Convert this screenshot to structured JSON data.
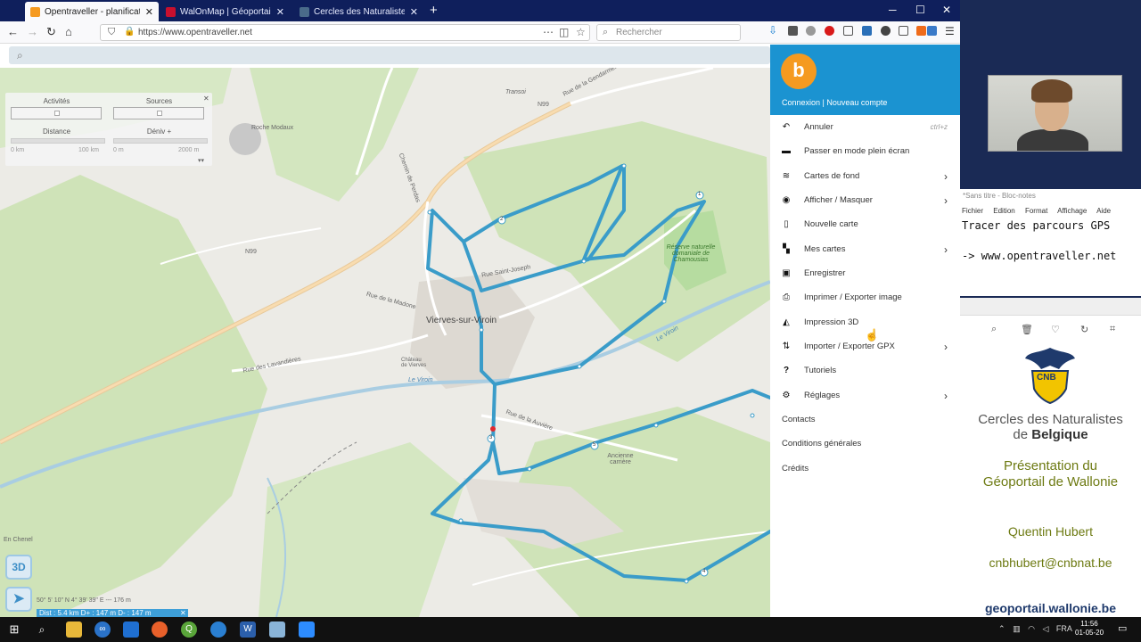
{
  "browser": {
    "tabs": [
      {
        "label": "Opentraveller - planificateur d'it",
        "color": "#f59a20",
        "active": true
      },
      {
        "label": "WalOnMap | Géoportail de la W",
        "color": "#c8102e",
        "active": false
      },
      {
        "label": "Cercles des Naturalistes de Belg",
        "color": "#4a6b8a",
        "active": false
      }
    ],
    "url": "https://www.opentraveller.net",
    "search_placeholder": "Rechercher"
  },
  "filter_panel": {
    "activities_label": "Activités",
    "sources_label": "Sources",
    "distance_label": "Distance",
    "elevation_label": "Déniv +",
    "dist_min": "0 km",
    "dist_max": "100 km",
    "elev_min": "0 m",
    "elev_max": "2000 m"
  },
  "map_labels": {
    "roche_modaux": "Roche Modaux",
    "n99_a": "N99",
    "n99_b": "N99",
    "gendarmerie": "Rue de la Gendarmerie",
    "transoi": "Transoi",
    "viroinval": "Vierves-sur-Viroin",
    "reserve": "Réserve naturelle domaniale de Chamousias",
    "lavandieres": "Rue des Lavandières",
    "viroin": "Le Viroin",
    "viroin2": "Le Viroin",
    "chenel": "En Chenel",
    "ancienne": "Ancienne carrière",
    "chateau": "Château de Vierves",
    "sinsel": "Rue Saint-Joseph",
    "chemin": "Chemin de Perdas",
    "modave": "Rue de la Madone",
    "auviere": "Rue de la Auvière"
  },
  "route_markers": [
    "1",
    "2",
    "3",
    "4",
    "5"
  ],
  "map_footer": {
    "coords": "50° 5' 10\" N  4° 39' 39\" E  ---  176 m",
    "dist": "Dist : 5.4 km   D+ : 147 m   D- : 147 m",
    "btn_3d": "3D"
  },
  "menu": {
    "logo": "b",
    "login": "Connexion | Nouveau compte",
    "items": [
      {
        "label": "Annuler",
        "icon": "undo-icon",
        "glyph": "↶",
        "shortcut": "ctrl+z",
        "arrow": false
      },
      {
        "label": "Passer en mode plein écran",
        "icon": "fullscreen-icon",
        "glyph": "▬",
        "shortcut": "",
        "arrow": false
      },
      {
        "label": "Cartes de fond",
        "icon": "layers-icon",
        "glyph": "≋",
        "shortcut": "",
        "arrow": true
      },
      {
        "label": "Afficher / Masquer",
        "icon": "eye-icon",
        "glyph": "◉",
        "shortcut": "",
        "arrow": true
      },
      {
        "label": "Nouvelle carte",
        "icon": "new-file-icon",
        "glyph": "▯",
        "shortcut": "",
        "arrow": false
      },
      {
        "label": "Mes cartes",
        "icon": "map-icon",
        "glyph": "▚",
        "shortcut": "",
        "arrow": true
      },
      {
        "label": "Enregistrer",
        "icon": "save-icon",
        "glyph": "▣",
        "shortcut": "",
        "arrow": false
      },
      {
        "label": "Imprimer / Exporter image",
        "icon": "printer-icon",
        "glyph": "⎙",
        "shortcut": "",
        "arrow": false
      },
      {
        "label": "Impression 3D",
        "icon": "print-3d-icon",
        "glyph": "◭",
        "shortcut": "",
        "arrow": false
      },
      {
        "label": "Importer / Exporter GPX",
        "icon": "import-export-icon",
        "glyph": "⇅",
        "shortcut": "",
        "arrow": true
      },
      {
        "label": "Tutoriels",
        "icon": "question-icon",
        "glyph": "?",
        "shortcut": "",
        "arrow": false
      },
      {
        "label": "Réglages",
        "icon": "gear-icon",
        "glyph": "⚙",
        "shortcut": "",
        "arrow": true
      }
    ],
    "links": [
      "Contacts",
      "Conditions générales",
      "Crédits"
    ]
  },
  "notepad": {
    "title": "*Sans titre - Bloc-notes",
    "menu": [
      "Fichier",
      "Edition",
      "Format",
      "Affichage",
      "Aide"
    ],
    "line1": "Tracer des parcours GPS",
    "line2": "-> www.opentraveller.net"
  },
  "slide": {
    "org_line1": "Cercles des Naturalistes",
    "org_line2_pre": "de ",
    "org_line2_bold": "Belgique",
    "crest": "CNB",
    "title1": "Présentation du",
    "title2": "Géoportail de Wallonie",
    "author": "Quentin Hubert",
    "email": "cnbhubert@cnbnat.be",
    "website": "geoportail.wallonie.be"
  },
  "taskbar": {
    "lang": "FRA",
    "time": "11:56",
    "date": "01-05-20"
  },
  "colors": {
    "route": "#3a9cc9",
    "menu_header": "#1b93d1",
    "logo": "#f59a20"
  }
}
